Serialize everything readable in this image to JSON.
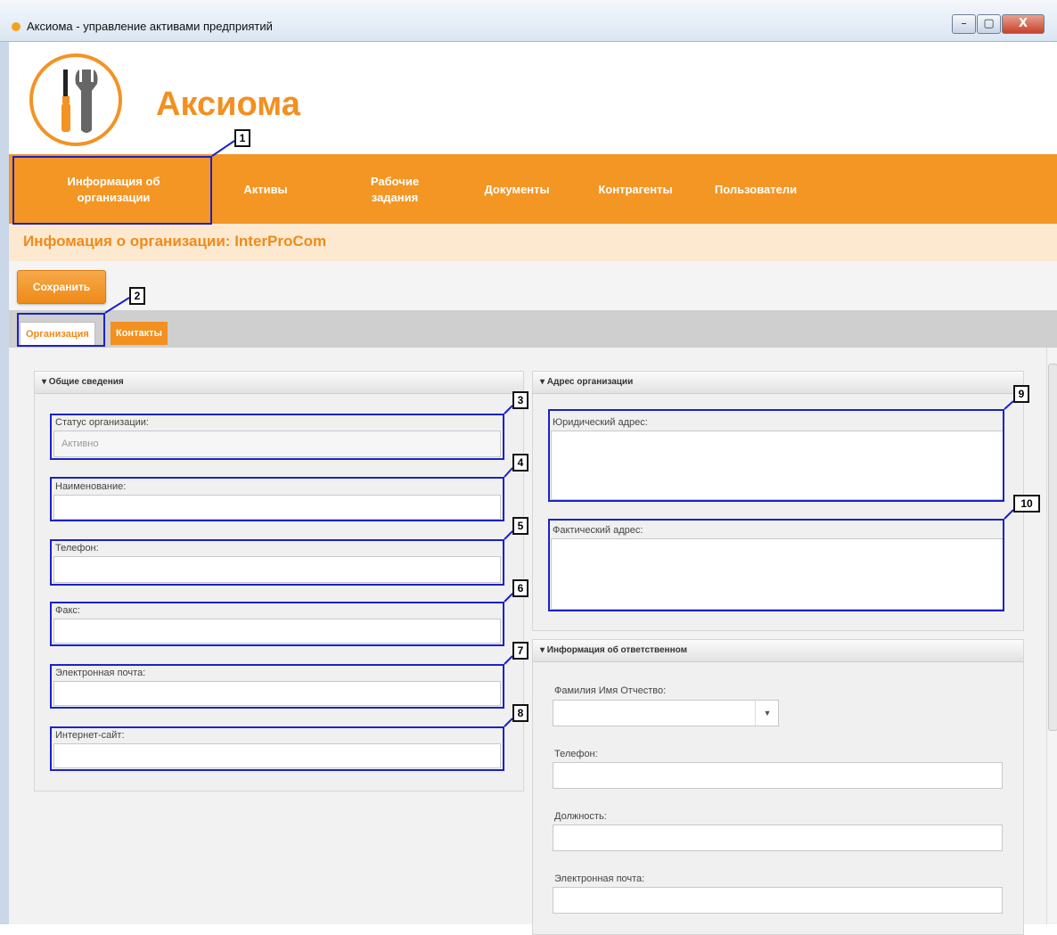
{
  "window": {
    "title": "Аксиома - управление активами предприятий",
    "minimize": "–",
    "maximize": "▢",
    "close": "X"
  },
  "app": {
    "brand": "Аксиома"
  },
  "nav": {
    "items": [
      {
        "line1": "Информация об",
        "line2": "организации"
      },
      {
        "line1": "Активы",
        "line2": ""
      },
      {
        "line1": "Рабочие",
        "line2": "задания"
      },
      {
        "line1": "Документы",
        "line2": ""
      },
      {
        "line1": "Контрагенты",
        "line2": ""
      },
      {
        "line1": "Пользователи",
        "line2": ""
      }
    ]
  },
  "infobar": {
    "title": "Инфомация о организации: InterProCom"
  },
  "toolbar": {
    "save_label": "Сохранить"
  },
  "tabs": [
    {
      "label": "Организация",
      "active": true
    },
    {
      "label": "Контакты",
      "active": false
    }
  ],
  "general": {
    "header": "▾  Общие сведения",
    "status_label": "Статус организации:",
    "status_value": "Активно",
    "name_label": "Наименование:",
    "phone_label": "Телефон:",
    "fax_label": "Факс:",
    "email_label": "Электронная почта:",
    "site_label": "Интернет-сайт:"
  },
  "address": {
    "header": "▾  Адрес организации",
    "legal_label": "Юридический адрес:",
    "actual_label": "Фактический адрес:"
  },
  "responsible": {
    "header": "▾  Информация об ответственном",
    "fio_label": "Фамилия Имя Отчество:",
    "phone_label": "Телефон:",
    "position_label": "Должность:",
    "email_label": "Электронная почта:"
  },
  "callouts": [
    "1",
    "2",
    "3",
    "4",
    "5",
    "6",
    "7",
    "8",
    "9",
    "10"
  ],
  "icons": {
    "dropdown": "chevron-down-icon",
    "logo": "tools-icon"
  },
  "colors": {
    "accent": "#f39624",
    "callout": "#1a22c9"
  }
}
